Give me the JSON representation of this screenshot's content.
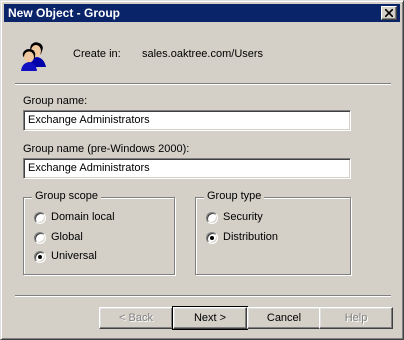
{
  "window": {
    "title": "New Object - Group",
    "close_symbol": "close-icon"
  },
  "header": {
    "icon": "group-icon",
    "create_in_label": "Create in:",
    "create_in_path": "sales.oaktree.com/Users"
  },
  "form": {
    "group_name_label": "Group name:",
    "group_name_value": "Exchange Administrators",
    "group_name_pre2000_label": "Group name (pre-Windows 2000):",
    "group_name_pre2000_value": "Exchange Administrators"
  },
  "group_scope": {
    "legend": "Group scope",
    "options": [
      {
        "label": "Domain local",
        "checked": false
      },
      {
        "label": "Global",
        "checked": false
      },
      {
        "label": "Universal",
        "checked": true
      }
    ]
  },
  "group_type": {
    "legend": "Group type",
    "options": [
      {
        "label": "Security",
        "checked": false
      },
      {
        "label": "Distribution",
        "checked": true
      }
    ]
  },
  "buttons": {
    "back": "< Back",
    "next": "Next >",
    "cancel": "Cancel",
    "help": "Help"
  }
}
